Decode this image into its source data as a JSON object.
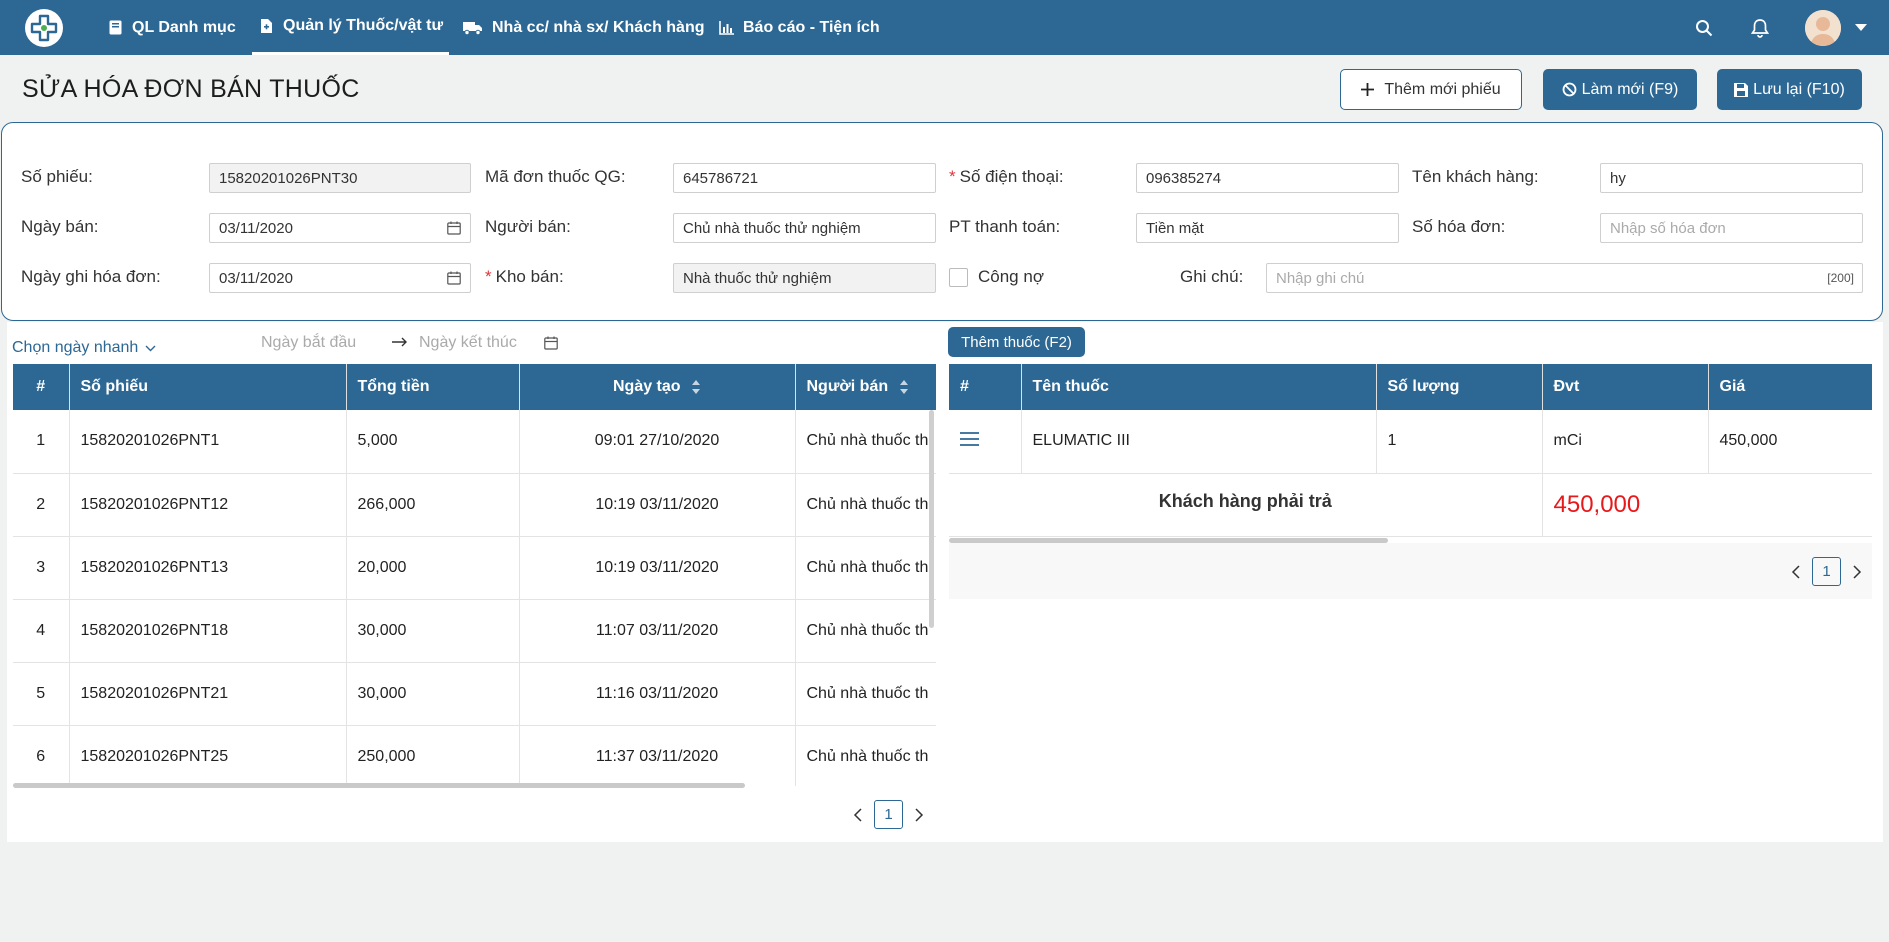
{
  "nav": {
    "items": [
      {
        "label": "QL Danh mục",
        "icon": "book-icon"
      },
      {
        "label": "Quản lý Thuốc/vật tư",
        "icon": "drug-file-icon"
      },
      {
        "label": "Nhà cc/ nhà sx/ Khách hàng",
        "icon": "truck-icon"
      },
      {
        "label": "Báo cáo - Tiện ích",
        "icon": "bar-chart-icon"
      }
    ],
    "active_index": 1
  },
  "page": {
    "title": "SỬA HÓA ĐƠN BÁN THUỐC"
  },
  "actions": {
    "add_new": "Thêm mới phiếu",
    "refresh": "Làm mới (F9)",
    "save": "Lưu lại (F10)"
  },
  "form": {
    "so_phieu_label": "Số phiếu:",
    "so_phieu_value": "15820201026PNT30",
    "ma_don_label": "Mã đơn thuốc QG:",
    "ma_don_value": "645786721",
    "sdt_label": "Số điện thoại:",
    "sdt_value": "096385274",
    "ten_kh_label": "Tên khách hàng:",
    "ten_kh_value": "hy",
    "ngay_ban_label": "Ngày bán:",
    "ngay_ban_value": "03/11/2020",
    "nguoi_ban_label": "Người bán:",
    "nguoi_ban_value": "Chủ nhà thuốc thử nghiệm",
    "pt_tt_label": "PT thanh toán:",
    "pt_tt_value": "Tiền mặt",
    "so_hd_label": "Số hóa đơn:",
    "so_hd_placeholder": "Nhập số hóa đơn",
    "ngay_ghi_label": "Ngày ghi hóa đơn:",
    "ngay_ghi_value": "03/11/2020",
    "kho_ban_label": "Kho bán:",
    "kho_ban_value": "Nhà thuốc thử nghiệm",
    "cong_no_label": "Công nợ",
    "ghi_chu_label": "Ghi chú:",
    "ghi_chu_placeholder": "Nhập ghi chú",
    "ghi_chu_max": "[200]"
  },
  "filter": {
    "quick_date": "Chọn ngày nhanh",
    "start_placeholder": "Ngày bắt đầu",
    "end_placeholder": "Ngày kết thúc"
  },
  "list_table": {
    "headers": [
      "#",
      "Số phiếu",
      "Tổng tiền",
      "Ngày tạo",
      "Người bán"
    ],
    "rows": [
      [
        "1",
        "15820201026PNT1",
        "5,000",
        "09:01 27/10/2020",
        "Chủ nhà thuốc th"
      ],
      [
        "2",
        "15820201026PNT12",
        "266,000",
        "10:19 03/11/2020",
        "Chủ nhà thuốc th"
      ],
      [
        "3",
        "15820201026PNT13",
        "20,000",
        "10:19 03/11/2020",
        "Chủ nhà thuốc th"
      ],
      [
        "4",
        "15820201026PNT18",
        "30,000",
        "11:07 03/11/2020",
        "Chủ nhà thuốc th"
      ],
      [
        "5",
        "15820201026PNT21",
        "30,000",
        "11:16 03/11/2020",
        "Chủ nhà thuốc th"
      ],
      [
        "6",
        "15820201026PNT25",
        "250,000",
        "11:37 03/11/2020",
        "Chủ nhà thuốc th"
      ]
    ],
    "page": "1"
  },
  "drug_table": {
    "add_button": "Thêm thuốc (F2)",
    "headers": [
      "#",
      "Tên thuốc",
      "Số lượng",
      "Đvt",
      "Giá"
    ],
    "rows": [
      [
        "",
        "ELUMATIC III",
        "1",
        "mCi",
        "450,000"
      ]
    ],
    "total_label": "Khách hàng phải trả",
    "total_value": "450,000",
    "page": "1"
  },
  "colors": {
    "primary": "#2d6894",
    "total_red": "#e8191a"
  }
}
